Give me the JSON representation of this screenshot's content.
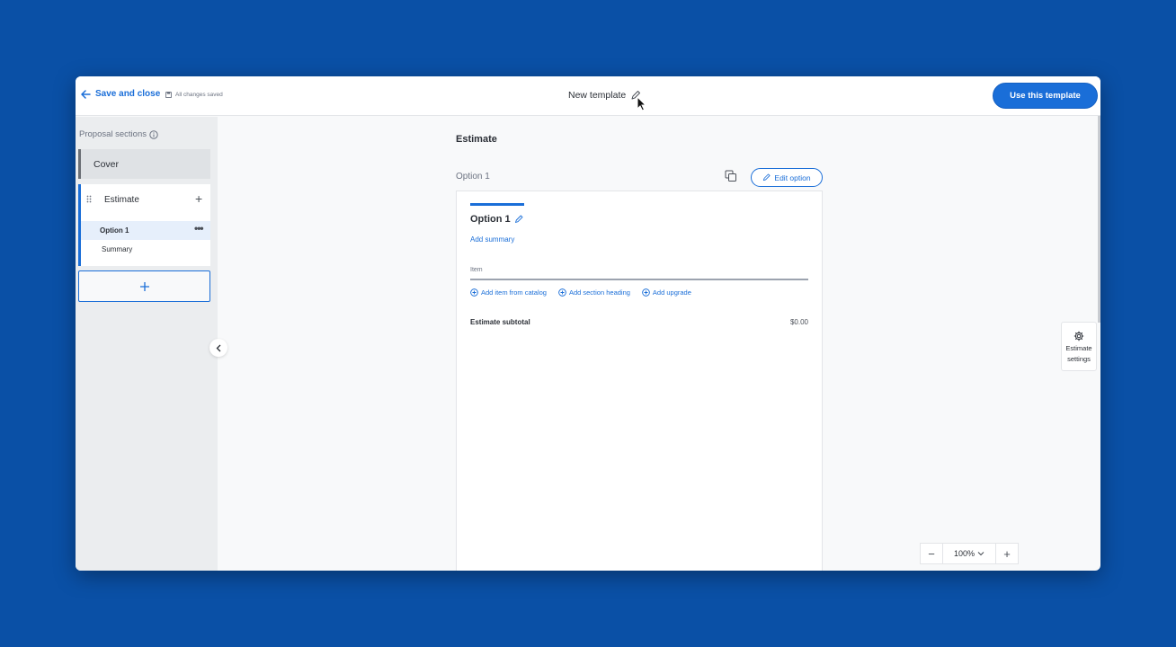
{
  "header": {
    "back_label": "Save and close",
    "saved_status": "All changes saved",
    "title": "New template",
    "use_button": "Use this template"
  },
  "sidebar": {
    "heading": "Proposal sections",
    "cover": "Cover",
    "estimate": {
      "label": "Estimate",
      "options": [
        {
          "label": "Option 1",
          "selected": true
        },
        {
          "label": "Summary",
          "selected": false
        }
      ]
    }
  },
  "main": {
    "section_title": "Estimate",
    "option_heading": "Option 1",
    "edit_option": "Edit option",
    "card": {
      "title": "Option 1",
      "add_summary": "Add summary",
      "item_placeholder": "Item",
      "links": [
        "Add item from catalog",
        "Add section heading",
        "Add upgrade"
      ],
      "subtotal_label": "Estimate subtotal",
      "subtotal_value": "$0.00"
    }
  },
  "settings": {
    "label_line1": "Estimate",
    "label_line2": "settings"
  },
  "zoom": {
    "value": "100%"
  },
  "colors": {
    "background": "#0a50a6",
    "accent": "#1a6ed8"
  }
}
